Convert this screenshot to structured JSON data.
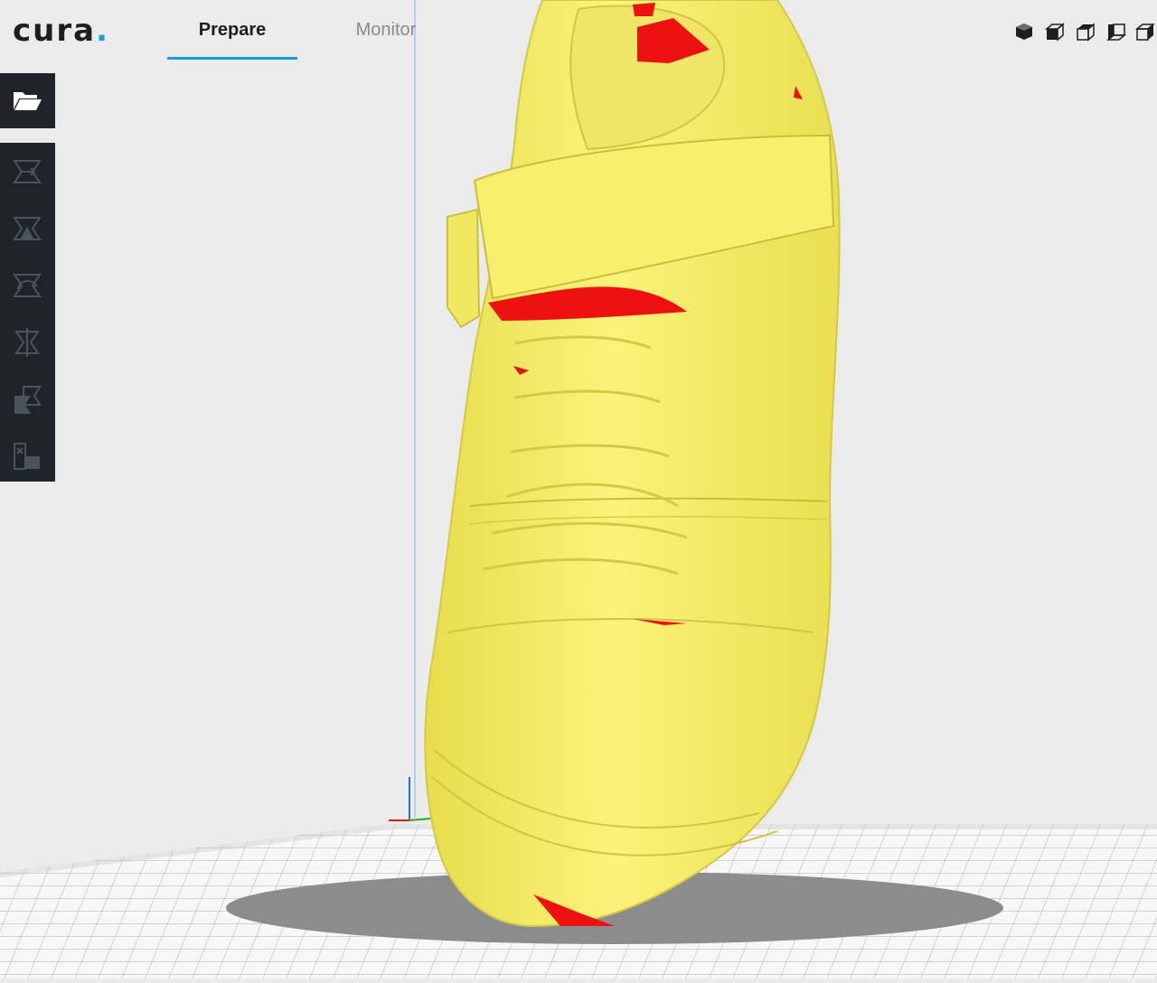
{
  "app": {
    "logo_text": "cura",
    "logo_dot": ".",
    "accent_color": "#1a9bdb"
  },
  "tabs": [
    {
      "label": "Prepare",
      "active": true
    },
    {
      "label": "Monitor",
      "active": false
    }
  ],
  "view_buttons": [
    {
      "icon": "view-3d-icon"
    },
    {
      "icon": "view-front-icon"
    },
    {
      "icon": "view-top-icon"
    },
    {
      "icon": "view-left-icon"
    },
    {
      "icon": "view-right-icon"
    }
  ],
  "sidebar": {
    "open_button_icon": "folder-open-icon",
    "tools": [
      {
        "icon": "translate-tool-icon"
      },
      {
        "icon": "scale-tool-icon"
      },
      {
        "icon": "rotate-tool-icon"
      },
      {
        "icon": "mirror-tool-icon"
      },
      {
        "icon": "per-model-settings-icon"
      },
      {
        "icon": "support-blocker-icon"
      }
    ]
  },
  "model": {
    "color": "#f6ee5e",
    "overhang_color": "#ee1111"
  }
}
